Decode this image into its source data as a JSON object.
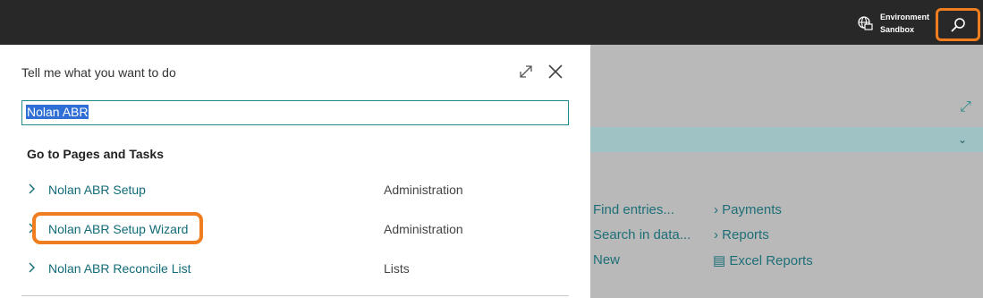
{
  "topbar": {
    "environment_label": "Environment",
    "environment_name": "Sandbox",
    "environment_icon": "globe-building-icon",
    "search_icon": "search-icon",
    "highlight_color": "#f07d1e"
  },
  "dialog": {
    "title": "Tell me what you want to do",
    "expand_icon": "expand-icon",
    "close_icon": "close-icon",
    "search_value": "Nolan ABR",
    "section_heading": "Go to Pages and Tasks",
    "results": [
      {
        "label": "Nolan ABR Setup",
        "category": "Administration"
      },
      {
        "label": "Nolan ABR Setup Wizard",
        "category": "Administration"
      },
      {
        "label": "Nolan ABR Reconcile List",
        "category": "Lists"
      }
    ]
  },
  "background": {
    "links_col1": [
      "Find entries...",
      "Search in data...",
      "New"
    ],
    "links_col2": [
      "Payments",
      "Reports",
      "Excel Reports"
    ]
  }
}
